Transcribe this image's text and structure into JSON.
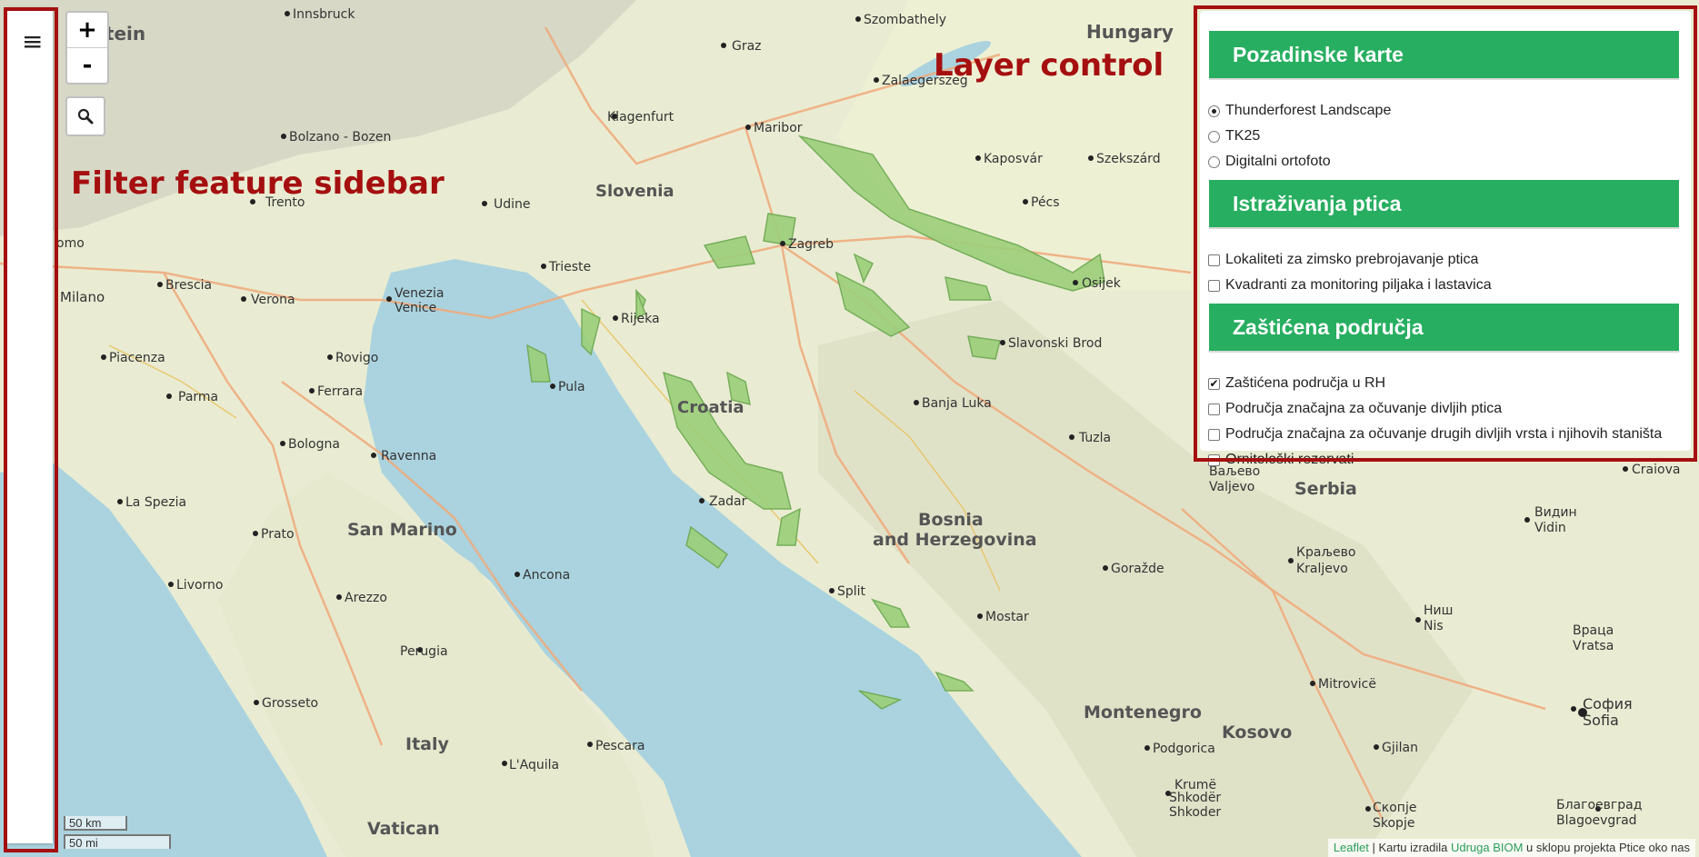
{
  "sidebar": {
    "toggle_icon": "menu-icon"
  },
  "zoom": {
    "in": "+",
    "out": "-"
  },
  "search": {
    "icon": "search-icon"
  },
  "annotations": {
    "sidebar_label": "Filter feature sidebar",
    "layer_label": "Layer control"
  },
  "layer_control": {
    "sections": [
      {
        "title": "Pozadinske karte",
        "type": "radio",
        "options": [
          {
            "label": "Thunderforest Landscape",
            "checked": true
          },
          {
            "label": "TK25",
            "checked": false
          },
          {
            "label": "Digitalni ortofoto",
            "checked": false
          }
        ]
      },
      {
        "title": "Istraživanja ptica",
        "type": "checkbox",
        "options": [
          {
            "label": "Lokaliteti za zimsko prebrojavanje ptica",
            "checked": false
          },
          {
            "label": "Kvadranti za monitoring piljaka i lastavica",
            "checked": false
          }
        ]
      },
      {
        "title": "Zaštićena područja",
        "type": "checkbox",
        "options": [
          {
            "label": "Zaštićena područja u RH",
            "checked": true
          },
          {
            "label": "Područja značajna za očuvanje divljih ptica",
            "checked": false
          },
          {
            "label": "Područja značajna za očuvanje drugih divljih vrsta i njihovih staništa",
            "checked": false
          },
          {
            "label": "Ornitološki rezervati",
            "checked": false
          }
        ]
      }
    ]
  },
  "scale": {
    "km": "50 km",
    "mi": "50 mi"
  },
  "attribution": {
    "leaflet": "Leaflet",
    "sep": " | Kartu izradila ",
    "org": "Udruga BIOM",
    "tail": " u sklopu projekta Ptice oko nas"
  },
  "map_labels": [
    "Innsbruck",
    "Szombathely",
    "Hungary",
    "Graz",
    "Zalaegerszeg",
    "stein",
    "Klagenfurt",
    "Maribor",
    "Bolzano - Bozen",
    "Kaposvár",
    "Szekszárd",
    "Trento",
    "Udine",
    "Slovenia",
    "Pécs",
    "Zagreb",
    "Trieste",
    "Brescia",
    "Verona",
    "Venezia",
    "Venice",
    "Milano",
    "Rijeka",
    "Osijek",
    "Piacenza",
    "Rovigo",
    "Slavonski Brod",
    "Parma",
    "Ferrara",
    "Pula",
    "Croatia",
    "Banja Luka",
    "Bologna",
    "Ravenna",
    "Tuzla",
    "Ваљево",
    "Valjevo",
    "Serbia",
    "Craiova",
    "La Spezia",
    "Zadar",
    "Bosnia",
    "and Herzegovina",
    "Видин",
    "Vidin",
    "Prato",
    "San Marino",
    "Ancona",
    "Goražde",
    "Краљево",
    "Kraljevo",
    "Livorno",
    "Arezzo",
    "Split",
    "Mostar",
    "Ниш",
    "Nis",
    "Враца",
    "Vratsa",
    "Perugia",
    "Mitrovicë",
    "Grosseto",
    "София",
    "Sofia",
    "Montenegro",
    "Kosovo",
    "Italy",
    "Pescara",
    "Podgorica",
    "Gjilan",
    "L'Aquila",
    "Krumë",
    "Shkodër",
    "Shkoder",
    "Скопје",
    "Skopje",
    "Благоевград",
    "Blagoevgrad",
    "Vatican",
    "omo"
  ]
}
